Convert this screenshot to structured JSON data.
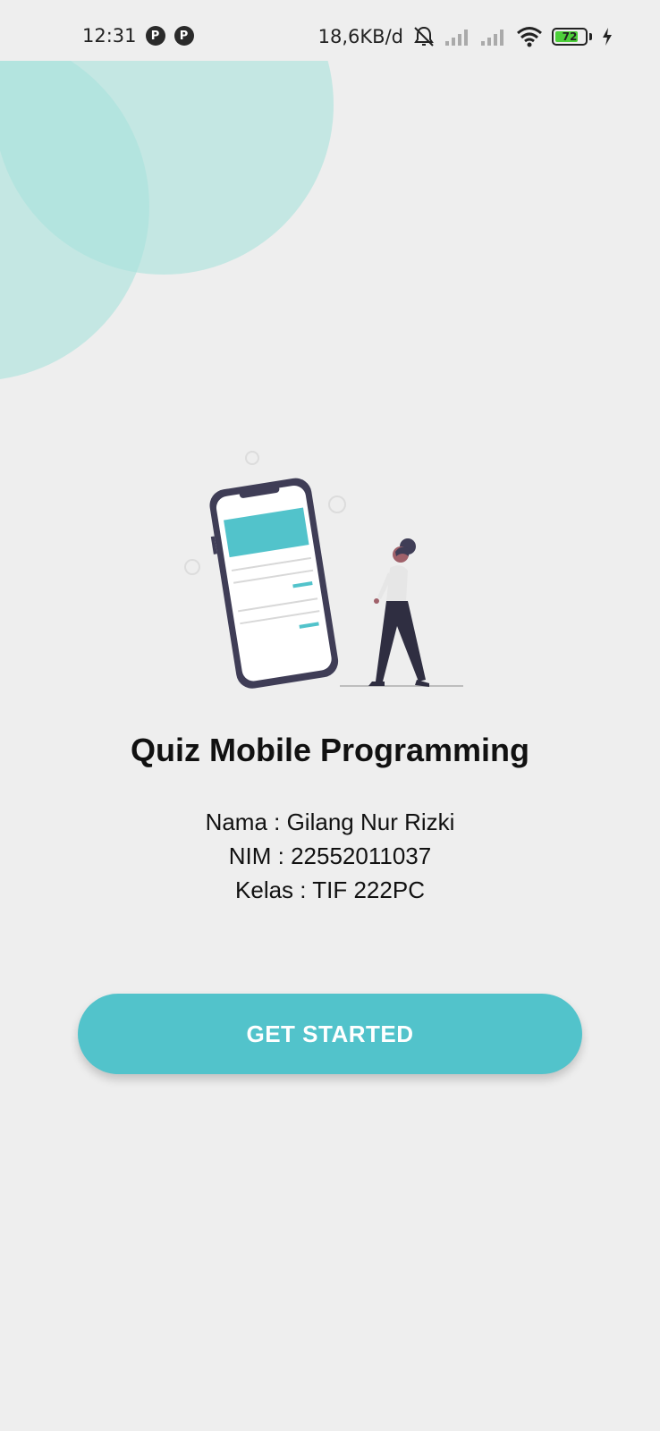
{
  "status_bar": {
    "time": "12:31",
    "app_icons": [
      "P",
      "P"
    ],
    "net_speed": "18,6KB/d",
    "battery": "72"
  },
  "app": {
    "title": "Quiz Mobile Programming",
    "info": [
      "Nama : Gilang Nur Rizki",
      "NIM : 22552011037",
      "Kelas : TIF 222PC"
    ],
    "cta_label": "GET STARTED"
  },
  "colors": {
    "background": "#eeeeee",
    "accent": "#52c3cb",
    "decor_circle": "#a8e3dc"
  }
}
